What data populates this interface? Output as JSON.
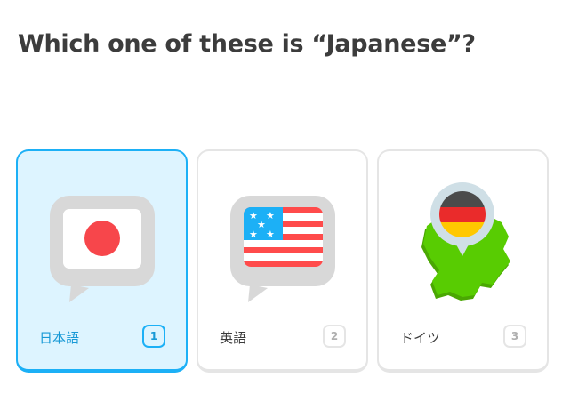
{
  "question": {
    "title": "Which one of these is “Japanese”?"
  },
  "choices": [
    {
      "label": "日本語",
      "key": "1",
      "icon": "japan-flag-speech-bubble-icon",
      "selected": true
    },
    {
      "label": "英語",
      "key": "2",
      "icon": "us-flag-speech-bubble-icon",
      "selected": false
    },
    {
      "label": "ドイツ",
      "key": "3",
      "icon": "germany-map-pin-icon",
      "selected": false
    }
  ],
  "colors": {
    "selected_border": "#1cb0f6",
    "selected_bg": "#ddf4ff",
    "selected_text": "#1899d6",
    "card_border": "#e5e5e5",
    "text": "#3c3c3c",
    "japan_red": "#f7464b",
    "us_red": "#ff4b4b",
    "us_blue": "#1cb0f6",
    "germany_map_green": "#58cc02",
    "germany_black": "#4b4b4b",
    "germany_red": "#ea2b2b",
    "germany_gold": "#ffc800"
  }
}
